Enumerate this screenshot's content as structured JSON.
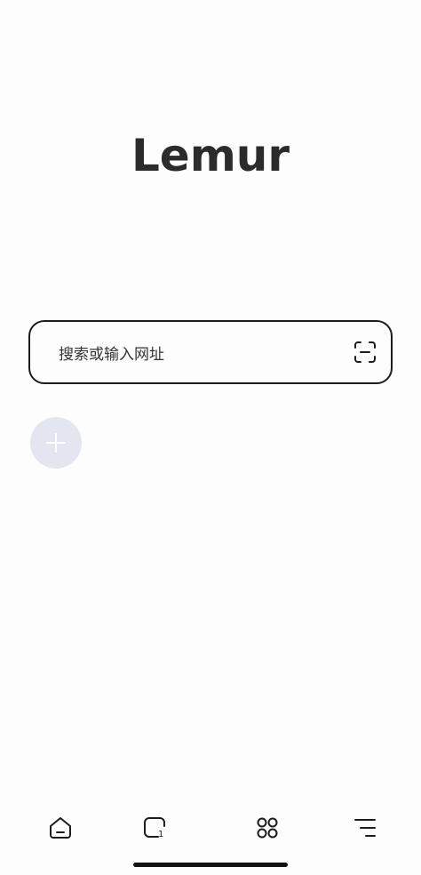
{
  "logo": {
    "text": "Lemur"
  },
  "search": {
    "placeholder": "搜索或输入网址"
  },
  "toolbar": {
    "tab_count": "1",
    "icons": [
      "home-icon",
      "tabs-icon",
      "grid-icon",
      "menu-icon"
    ]
  },
  "colors": {
    "background": "#fdfdfe",
    "text": "#2b2b2b",
    "add_button_bg": "#e3e6f0",
    "add_button_plus": "#ffffff"
  }
}
